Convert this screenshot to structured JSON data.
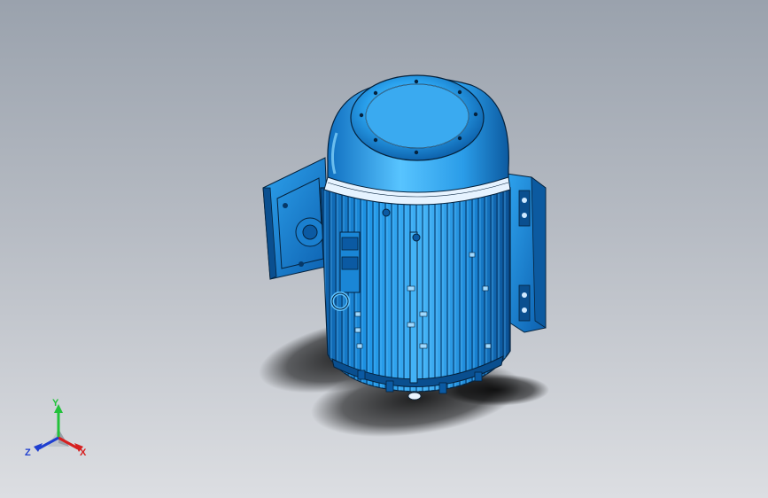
{
  "viewport": {
    "model": "electric-motor",
    "background_top": "#9aa2ad",
    "background_bottom": "#dcdee2"
  },
  "model": {
    "body_color": "#1a8fe0",
    "highlight_color": "#5ec2ff",
    "shadow_color": "#0a4f8f",
    "edge_color": "#05223d"
  },
  "triad": {
    "y_label": "Y",
    "x_label": "X",
    "z_label": "Z",
    "y_color": "#22c23a",
    "x_color": "#d62020",
    "z_color": "#1f3fd0"
  }
}
